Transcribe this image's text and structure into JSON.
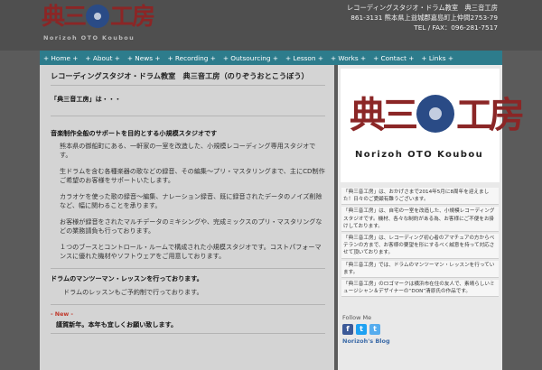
{
  "header": {
    "logo_jp_1": "典",
    "logo_jp_2": "三",
    "logo_jp_3": "音",
    "logo_jp_4": "工房",
    "logo_en": "Norizoh OTO Koubou",
    "info_name": "レコーディングスタジオ・ドラム教室　典三音工房",
    "info_address": "861-3131 熊本県上益城郡嘉島町上仲間2753-79",
    "info_tel": "TEL / FAX：096-281-7517"
  },
  "nav": {
    "items": [
      "+ Home +",
      "+ About +",
      "+ News +",
      "+ Recording +",
      "+ Outsourcing +",
      "+ Lesson +",
      "+ Works +",
      "+ Contact +",
      "+ Links +"
    ]
  },
  "main": {
    "title": "レコーディングスタジオ・ドラム教室　典三音工房（のりぞうおとこうぼう）",
    "intro": "「典三音工房」は・・・",
    "section1_heading": "音楽制作全般のサポートを目的とする小規模スタジオです",
    "p1": "熊本県の御船町にある、一軒家の一室を改造した、小規模レコーディング専用スタジオです。",
    "p2": "生ドラムを含む各種楽器の歌などの録音、その編集〜プリ・マスタリングまで、主にCD制作ご希望のお客様をサポートいたします。",
    "p3": "カラオケを使った歌の録音〜編集、ナレーション録音、既に録音されたデータのノイズ削除など、幅に関わることを承ります。",
    "p4": "お客様が録音をされたマルチデータのミキシングや、完成ミックスのプリ・マスタリングなどの業務請負も行っております。",
    "p5": "１つのブースとコントロール・ルームで構成された小規模スタジオです。コストパフォーマンスに優れた機材やソフトウェアをご用意しております。",
    "section2_heading": "ドラムのマンツーマン・レッスンを行っております。",
    "p6": "ドラムのレッスンもご予約制で行っております。",
    "new_label": "- New -",
    "new_item": "謹賀新年。本年も宜しくお願い致します。"
  },
  "side": {
    "logo_jp_1": "典",
    "logo_jp_2": "三",
    "logo_jp_3": "音",
    "logo_jp_4": "工房",
    "logo_en": "Norizoh OTO Koubou",
    "p1": "「典三音工房」は、おかげさまで2014年5月に8周年を迎えました！日々のご愛顧有難うございます。",
    "p2": "「典三音工房」は、自宅の一室を改造した、小規模レコーディングスタジオです。機材、各々な制約がある為、お客様にご不便をお掛けしております。",
    "p3": "「典三音工房」は、レコーディング初心者のアマチュアの方からベテランの方まで、お客様の要望を形にするべく誠意を持って対応させて頂いております。",
    "p4": "「典三音工房」では、ドラムのマンツーマン・レッスンを行っています。",
    "p5": "「典三音工房」のロゴマークは横浜市在住の友人で、素晴らしいミュージシャン＆デザイナーの“DON”清原氏の作品です。",
    "follow_label": "Follow Me",
    "social_icons": [
      "facebook-icon",
      "twitter-icon",
      "twitter-bird-icon"
    ],
    "social_glyphs": [
      "f",
      "t",
      "t"
    ],
    "blog_link": "Norizoh's Blog"
  },
  "colors": {
    "nav_bg": "#2d7c8c",
    "logo_red": "#8b2626",
    "logo_blue": "#2a4b86",
    "new_red": "#c0392b"
  }
}
